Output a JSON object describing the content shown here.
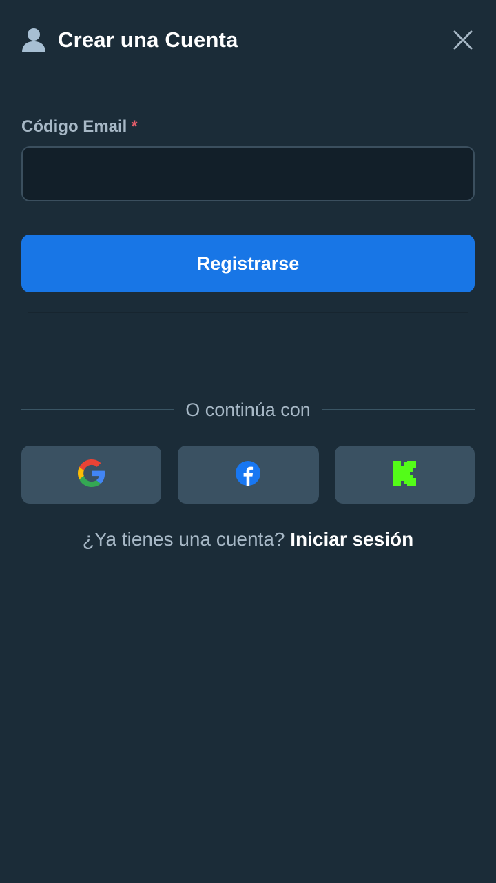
{
  "header": {
    "title": "Crear una Cuenta",
    "user_icon": "user-icon",
    "close_icon": "close-icon"
  },
  "form": {
    "email_label": "Código Email",
    "required_mark": "*",
    "email_value": "",
    "email_placeholder": "",
    "submit_label": "Registrarse"
  },
  "social": {
    "divider_text": "O continúa con",
    "providers": [
      {
        "name": "google",
        "icon": "google-icon"
      },
      {
        "name": "facebook",
        "icon": "facebook-icon"
      },
      {
        "name": "kick",
        "icon": "kick-icon"
      }
    ]
  },
  "footer": {
    "question": "¿Ya tienes una cuenta?",
    "login_link": "Iniciar sesión"
  },
  "colors": {
    "background": "#1b2c38",
    "primary": "#1876e6",
    "social_button": "#3a5162",
    "required": "#e35d6a",
    "kick_green": "#53fc18"
  }
}
